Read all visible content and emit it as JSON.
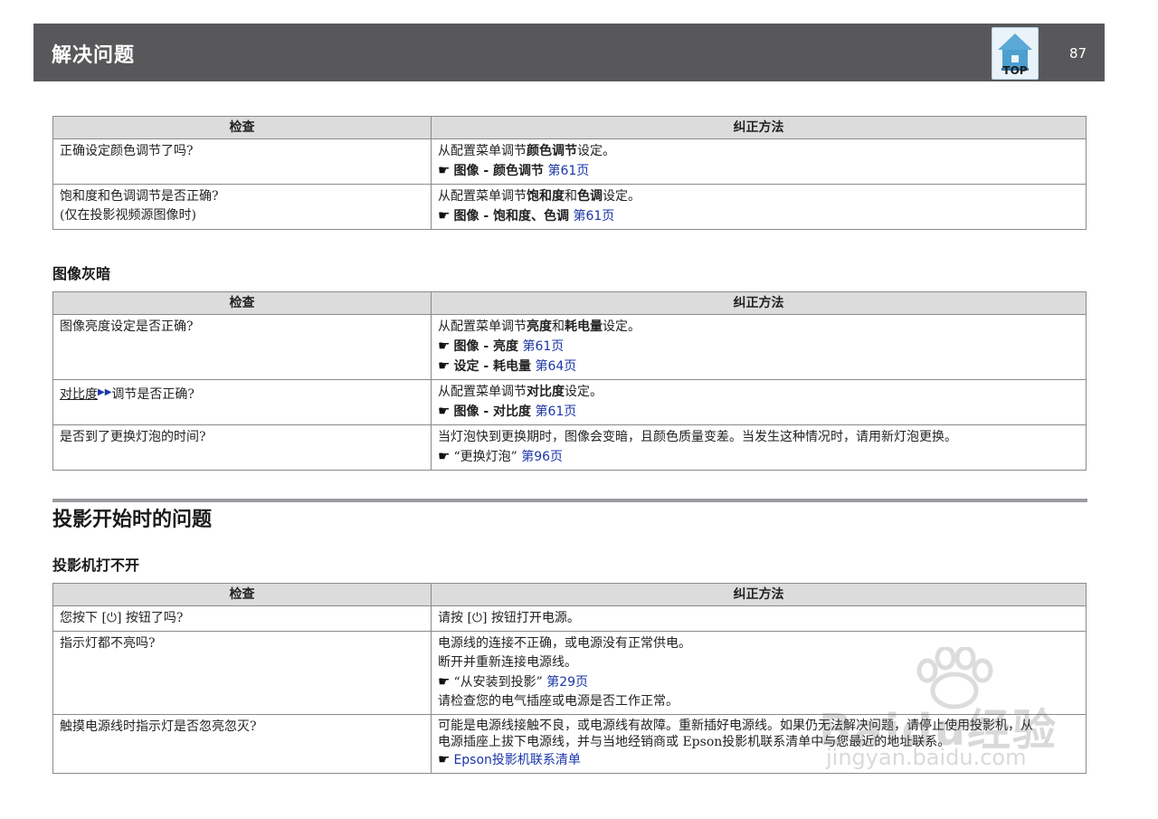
{
  "header": {
    "title": "解决问题",
    "page_number": "87",
    "top_label": "TOP"
  },
  "common": {
    "check": "检查",
    "remedy": "纠正方法",
    "ref_mark": "☛"
  },
  "table1": {
    "rows": [
      {
        "check": [
          "正确设定颜色调节了吗?"
        ],
        "remedy_parts": [
          {
            "t": "从配置菜单调节"
          },
          {
            "t": "颜色调节",
            "b": true
          },
          {
            "t": "设定。"
          }
        ],
        "refs": [
          {
            "text": "图像 - 颜色调节",
            "link": "第61页"
          }
        ]
      },
      {
        "check": [
          "饱和度和色调调节是否正确?",
          "(仅在投影视频源图像时)"
        ],
        "remedy_parts": [
          {
            "t": "从配置菜单调节"
          },
          {
            "t": "饱和度",
            "b": true
          },
          {
            "t": "和"
          },
          {
            "t": "色调",
            "b": true
          },
          {
            "t": "设定。"
          }
        ],
        "refs": [
          {
            "text": "图像 - 饱和度、色调",
            "link": "第61页"
          }
        ]
      }
    ]
  },
  "section_dark": {
    "title": "图像灰暗"
  },
  "table2": {
    "rows": [
      {
        "check": [
          "图像亮度设定是否正确?"
        ],
        "remedy_parts": [
          {
            "t": "从配置菜单调节"
          },
          {
            "t": "亮度",
            "b": true
          },
          {
            "t": "和"
          },
          {
            "t": "耗电量",
            "b": true
          },
          {
            "t": "设定。"
          }
        ],
        "refs": [
          {
            "text": "图像 - 亮度",
            "link": "第61页"
          },
          {
            "text": "设定 - 耗电量",
            "link": "第64页"
          }
        ]
      },
      {
        "check_term": "对比度",
        "check_rest": "调节是否正确?",
        "remedy_parts": [
          {
            "t": "从配置菜单调节"
          },
          {
            "t": "对比度",
            "b": true
          },
          {
            "t": "设定。"
          }
        ],
        "refs": [
          {
            "text": "图像 - 对比度",
            "link": "第61页"
          }
        ]
      },
      {
        "check": [
          "是否到了更换灯泡的时间?"
        ],
        "remedy_text": "当灯泡快到更换期时，图像会变暗，且颜色质量变差。当发生这种情况时，请用新灯泡更换。",
        "refs": [
          {
            "text": "“更换灯泡”",
            "link": "第96页"
          }
        ]
      }
    ]
  },
  "section_start": {
    "title": "投影开始时的问题"
  },
  "section_power": {
    "title": "投影机打不开"
  },
  "table3": {
    "rows": [
      {
        "check": "您按下 [⏻] 按钮了吗?",
        "remedy": "请按 [⏻] 按钮打开电源。"
      },
      {
        "check": "指示灯都不亮吗?",
        "lines": [
          "电源线的连接不正确，或电源没有正常供电。",
          "断开并重新连接电源线。"
        ],
        "ref": {
          "text": "“从安装到投影”",
          "link": "第29页"
        },
        "after": "请检查您的电气插座或电源是否工作正常。"
      },
      {
        "check": "触摸电源线时指示灯是否忽亮忽灭?",
        "lines": [
          "可能是电源线接触不良，或电源线有故障。重新插好电源线。如果仍无法解决问题，请停止使用投影机，从",
          "电源插座上拔下电源线，并与当地经销商或 Epson投影机联系清单中与您最近的地址联系。"
        ],
        "ref_link_only": "Epson投影机联系清单"
      }
    ]
  },
  "watermark": {
    "main": "Baidu经验",
    "sub": "jingyan.baidu.com"
  },
  "colors": {
    "header_bg": "#58585a",
    "th_bg": "#dcdcdc",
    "link": "#1b36a8"
  }
}
